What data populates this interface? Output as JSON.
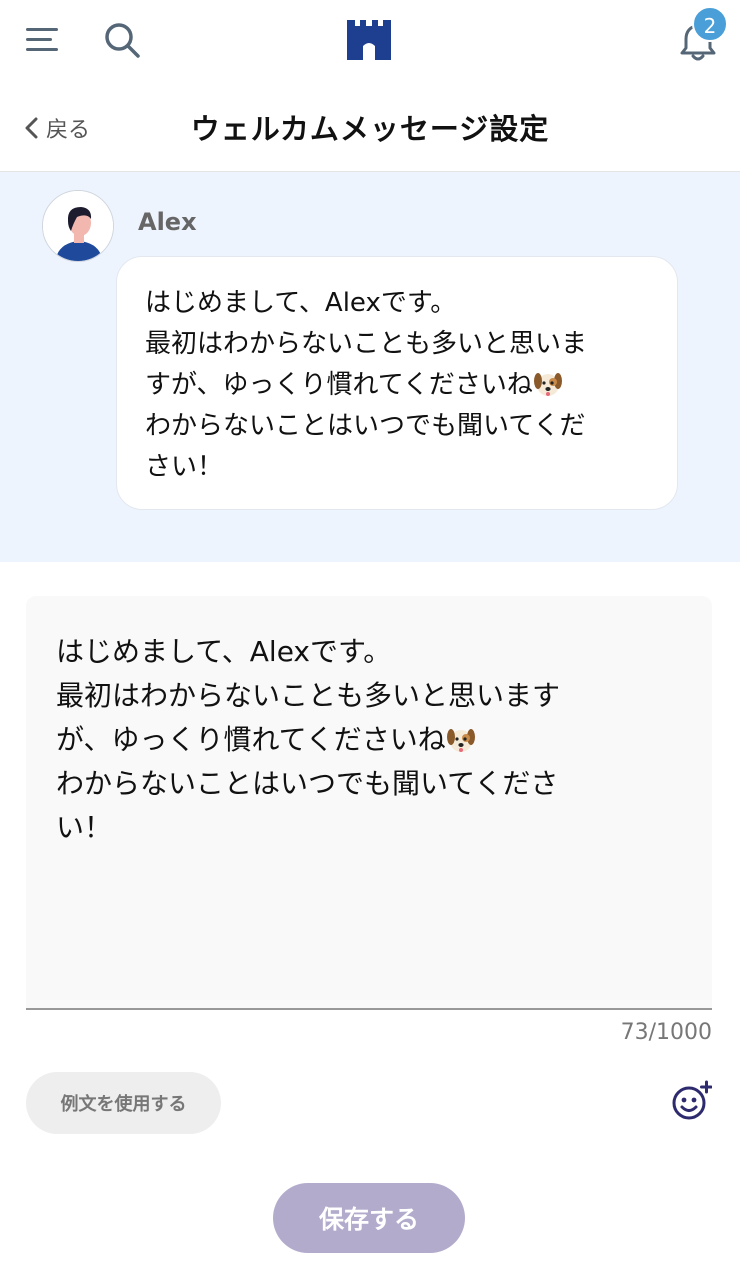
{
  "header": {
    "notification_count": "2",
    "icons": [
      "menu-icon",
      "search-icon",
      "castle-logo",
      "bell-icon"
    ]
  },
  "nav": {
    "back_label": "戻る",
    "title": "ウェルカムメッセージ設定"
  },
  "preview": {
    "sender_name": "Alex",
    "message_lines": [
      "はじめまして、Alexです。",
      "最初はわからないことも多いと思いま",
      "すが、ゆっくり慣れてくださいね",
      "わからないことはいつでも聞いてくだ",
      "さい！"
    ]
  },
  "editor": {
    "value_lines": [
      "はじめまして、Alexです。",
      "最初はわからないことも多いと思います",
      "が、ゆっくり慣れてくださいね",
      "わからないことはいつでも聞いてくださ",
      "い！"
    ],
    "counter": "73/1000"
  },
  "actions": {
    "sample_label": "例文を使用する",
    "save_label": "保存する"
  },
  "colors": {
    "accent": "#4a9fd8",
    "logo": "#1e3f8f",
    "preview_bg": "#eef4fe",
    "save_disabled": "#b3abcc",
    "emoji_button": "#2d2a6e"
  }
}
